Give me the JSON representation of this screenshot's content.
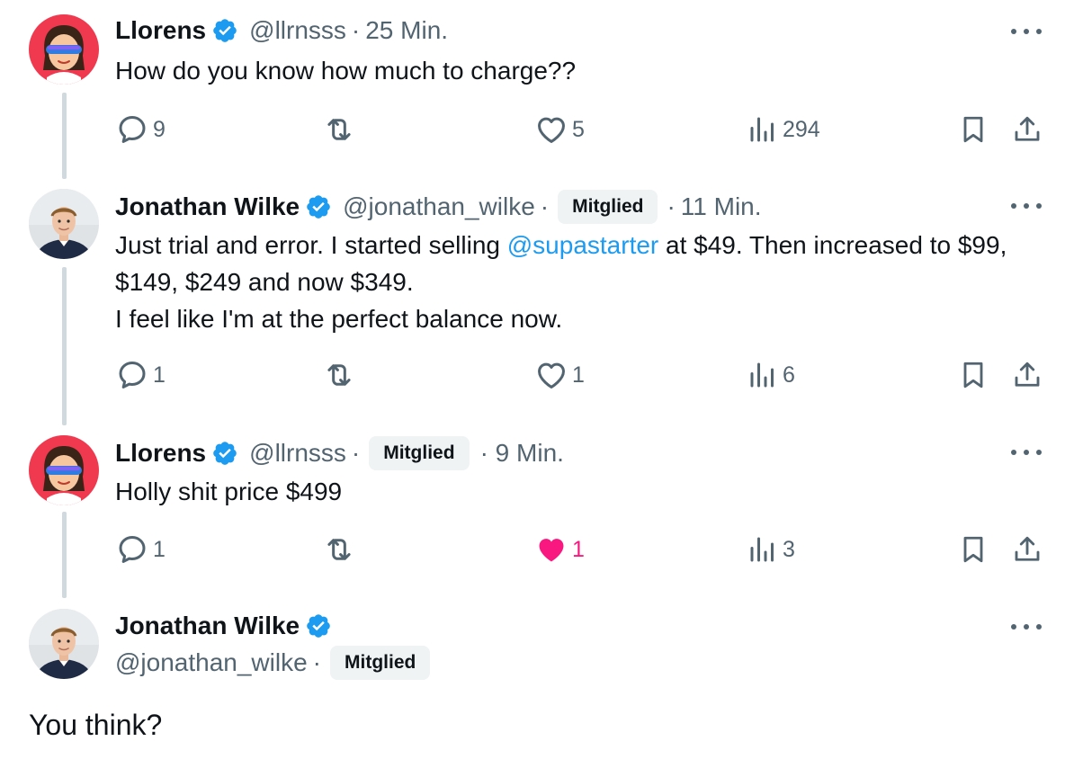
{
  "colors": {
    "text_primary": "#0f1419",
    "text_secondary": "#536471",
    "link": "#1d9bf0",
    "verified": "#1d9bf0",
    "like_active": "#f91880",
    "badge_bg": "#eff3f4",
    "thread_line": "#cfd9de"
  },
  "thread": [
    {
      "author_name": "Llorens",
      "handle": "@llrnsss",
      "separator": "·",
      "badge": "",
      "time": "25 Min.",
      "text": "How do you know how much to charge??",
      "avatar_icon": "sunglasses-memoji-avatar",
      "replies": "9",
      "retweets": "",
      "likes": "5",
      "liked": false,
      "views": "294"
    },
    {
      "author_name": "Jonathan Wilke",
      "handle": "@jonathan_wilke",
      "separator": "·",
      "badge": "Mitglied",
      "time": "11 Min.",
      "text_parts": {
        "before_mention": "Just trial and error. I started selling ",
        "mention": "@supastarter",
        "after_mention": " at $49. Then increased to $99, $149, $249 and now $349.",
        "line2": "I feel like I'm at the perfect balance now."
      },
      "avatar_icon": "profile-photo-avatar",
      "replies": "1",
      "retweets": "",
      "likes": "1",
      "liked": false,
      "views": "6"
    },
    {
      "author_name": "Llorens",
      "handle": "@llrnsss",
      "separator": "·",
      "badge": "Mitglied",
      "time": "· 9 Min.",
      "text": "Holly shit price $499",
      "avatar_icon": "sunglasses-memoji-avatar",
      "replies": "1",
      "retweets": "",
      "likes": "1",
      "liked": true,
      "views": "3"
    }
  ],
  "main_tweet": {
    "author_name": "Jonathan Wilke",
    "handle": "@jonathan_wilke",
    "separator": "·",
    "badge": "Mitglied",
    "text": "You think?",
    "avatar_icon": "profile-photo-avatar"
  },
  "icons": {
    "reply": "reply-icon",
    "retweet": "retweet-icon",
    "like": "heart-icon",
    "views": "views-chart-icon",
    "bookmark": "bookmark-icon",
    "share": "share-icon",
    "more": "more-options-icon",
    "verified": "verified-badge-icon"
  }
}
